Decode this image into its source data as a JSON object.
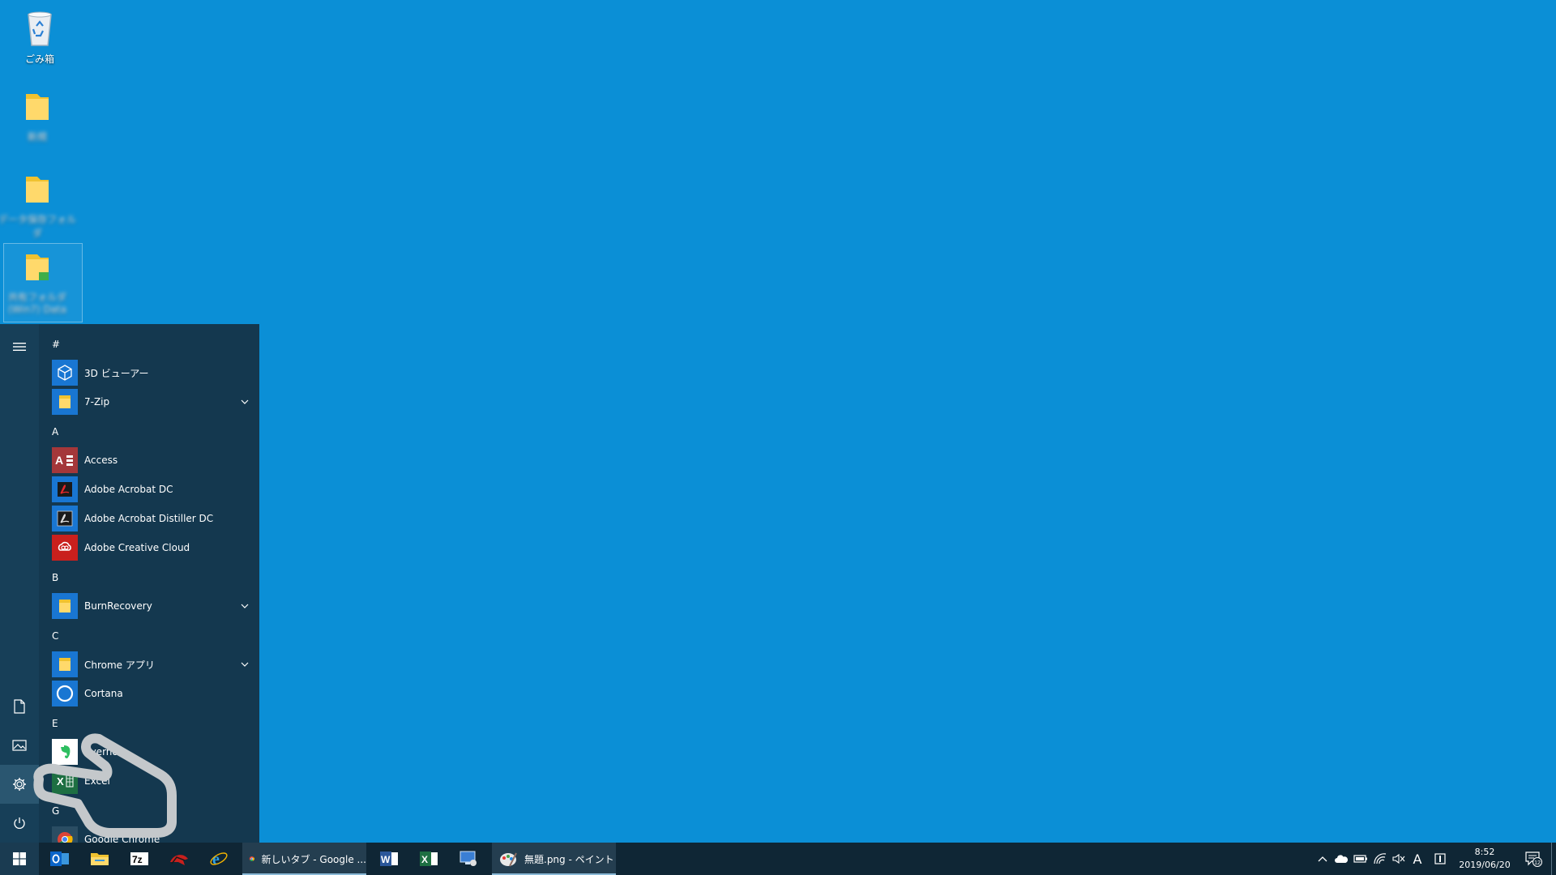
{
  "colors": {
    "desktop": "#0b8fd6",
    "start_menu": "#14384f",
    "taskbar": "#0f2635",
    "tile_blue": "#1976d2",
    "access_red": "#a4373a",
    "acrobat_red": "#c9201d"
  },
  "desktop": {
    "icons": [
      {
        "label": "ごみ箱",
        "icon": "recycle-bin-icon"
      },
      {
        "label": "新規",
        "icon": "folder-icon"
      },
      {
        "label": "データ保存フォルダ",
        "icon": "folder-icon"
      },
      {
        "label": "共有フォルダ (Win7) Data",
        "icon": "folder-shortcut-icon"
      }
    ]
  },
  "start_menu": {
    "rail": {
      "menu": "hamburger-icon",
      "documents": "document-icon",
      "pictures": "pictures-icon",
      "settings": "gear-icon",
      "power": "power-icon"
    },
    "groups": [
      {
        "header": "#",
        "apps": [
          {
            "label": "3D ビューアー",
            "icon": "cube-icon",
            "expandable": false
          },
          {
            "label": "7-Zip",
            "icon": "folder-icon",
            "expandable": true
          }
        ]
      },
      {
        "header": "A",
        "apps": [
          {
            "label": "Access",
            "icon": "access-icon",
            "expandable": false
          },
          {
            "label": "Adobe Acrobat DC",
            "icon": "acrobat-icon",
            "expandable": false
          },
          {
            "label": "Adobe Acrobat Distiller DC",
            "icon": "distiller-icon",
            "expandable": false
          },
          {
            "label": "Adobe Creative Cloud",
            "icon": "creative-cloud-icon",
            "expandable": false
          }
        ]
      },
      {
        "header": "B",
        "apps": [
          {
            "label": "BurnRecovery",
            "icon": "folder-icon",
            "expandable": true
          }
        ]
      },
      {
        "header": "C",
        "apps": [
          {
            "label": "Chrome アプリ",
            "icon": "folder-icon",
            "expandable": true
          },
          {
            "label": "Cortana",
            "icon": "cortana-icon",
            "expandable": false
          }
        ]
      },
      {
        "header": "E",
        "apps": [
          {
            "label": "Evernote",
            "icon": "evernote-icon",
            "expandable": false
          },
          {
            "label": "Excel",
            "icon": "excel-icon",
            "expandable": false
          }
        ]
      },
      {
        "header": "G",
        "apps": [
          {
            "label": "Google Chrome",
            "icon": "chrome-icon",
            "expandable": false
          }
        ]
      }
    ]
  },
  "taskbar": {
    "start": "windows-logo-icon",
    "pinned": [
      "outlook-icon",
      "file-explorer-icon",
      "7zip-icon",
      "red-app-icon",
      "internet-explorer-icon"
    ],
    "chrome_window": "新しいタブ - Google ...",
    "pinned_after": [
      "word-icon",
      "excel-icon",
      "remote-desktop-icon"
    ],
    "paint_window": "無題.png - ペイント",
    "tray": {
      "icons": [
        "chevron-up-icon",
        "onedrive-icon",
        "battery-icon",
        "wifi-icon",
        "mute-icon",
        "ime-icon",
        "security-icon"
      ],
      "ime_label": "A"
    },
    "clock": {
      "time": "8:52",
      "date": "2019/06/20"
    },
    "notifications": "12"
  }
}
